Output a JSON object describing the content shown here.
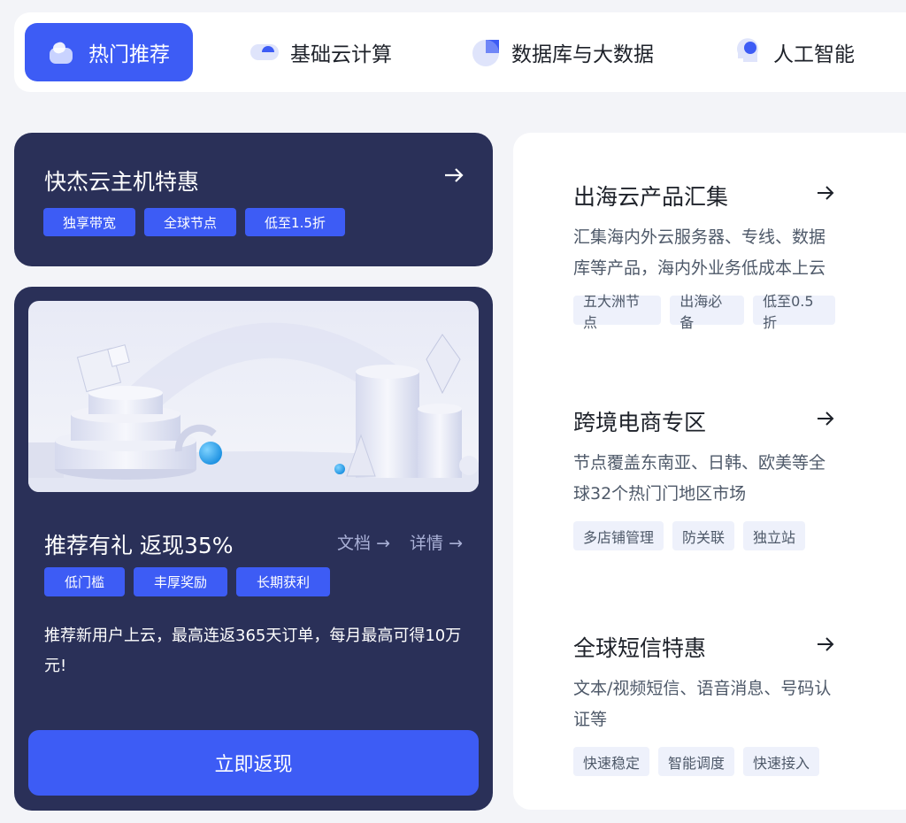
{
  "tabs": [
    {
      "label": "热门推荐",
      "icon": "hot-recommend-icon",
      "active": true
    },
    {
      "label": "基础云计算",
      "icon": "cloud-computing-icon",
      "active": false
    },
    {
      "label": "数据库与大数据",
      "icon": "database-icon",
      "active": false
    },
    {
      "label": "人工智能",
      "icon": "ai-icon",
      "active": false
    }
  ],
  "promo_host": {
    "title": "快杰云主机特惠",
    "tags": [
      "独享带宽",
      "全球节点",
      "低至1.5折"
    ]
  },
  "promo_referral": {
    "title": "推荐有礼 返现35%",
    "link_docs": "文档",
    "link_details": "详情",
    "tags": [
      "低门槛",
      "丰厚奖励",
      "长期获利"
    ],
    "description": "推荐新用户上云，最高连返365天订单，每月最高可得10万元!",
    "cta_label": "立即返现"
  },
  "products": [
    {
      "title": "出海云产品汇集",
      "description": "汇集海内外云服务器、专线、数据库等产品，海内外业务低成本上云",
      "tags": [
        "五大洲节点",
        "出海必备",
        "低至0.5折"
      ]
    },
    {
      "title": "跨境电商专区",
      "description": "节点覆盖东南亚、日韩、欧美等全球32个热门门地区市场",
      "tags": [
        "多店铺管理",
        "防关联",
        "独立站"
      ]
    },
    {
      "title": "全球短信特惠",
      "description": "文本/视频短信、语音消息、号码认证等",
      "tags": [
        "快速稳定",
        "智能调度",
        "快速接入"
      ]
    }
  ],
  "colors": {
    "accent": "#3d5cf5",
    "dark_card": "#2a3058",
    "page_bg": "#f3f4f8",
    "tag_light_bg": "#eef1fb",
    "text_secondary": "#4e5969",
    "link_muted": "#a9b0d6"
  }
}
